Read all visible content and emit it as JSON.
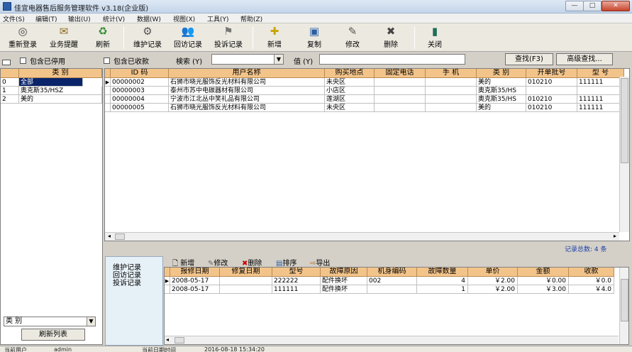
{
  "window": {
    "title": "佳宜电器售后服务管理软件 v3.18(企业版)",
    "minimize_label": "—",
    "maximize_label": "□",
    "close_label": "✕"
  },
  "menu": [
    "文件(S)",
    "编辑(T)",
    "输出(U)",
    "统计(V)",
    "数据(W)",
    "视图(X)",
    "工具(Y)",
    "帮助(Z)"
  ],
  "toolbar": [
    {
      "label": "重新登录",
      "icon": "relogin-icon",
      "glyph": "◎"
    },
    {
      "label": "业务提醒",
      "icon": "reminder-icon",
      "glyph": "✉"
    },
    {
      "label": "刷新",
      "icon": "refresh-icon",
      "glyph": "♻"
    },
    {
      "label": "维护记录",
      "icon": "maintenance-record-icon",
      "glyph": "⚙"
    },
    {
      "label": "回访记录",
      "icon": "revisit-record-icon",
      "glyph": "👥"
    },
    {
      "label": "投诉记录",
      "icon": "complaint-record-icon",
      "glyph": "⚑"
    },
    {
      "label": "新增",
      "icon": "add-icon",
      "glyph": "✚"
    },
    {
      "label": "复制",
      "icon": "copy-icon",
      "glyph": "▣"
    },
    {
      "label": "修改",
      "icon": "edit-icon",
      "glyph": "✎"
    },
    {
      "label": "删除",
      "icon": "delete-icon",
      "glyph": "✖"
    },
    {
      "label": "关闭",
      "icon": "close-door-icon",
      "glyph": "▮"
    }
  ],
  "filters": {
    "include_disabled": "包含已停用",
    "include_closed": "包含已收款",
    "search_label": "検索 (Y)",
    "search_value": "",
    "value_label": "值 (Y)",
    "value_input": "",
    "find_button": "查找(F3)",
    "advanced_button": "高级查找..."
  },
  "category_panel": {
    "header": "类    别",
    "items": [
      {
        "index": "0",
        "name": "全部",
        "selected": true
      },
      {
        "index": "1",
        "name": "奥克斯35/HSZ",
        "selected": false
      },
      {
        "index": "2",
        "name": "美的",
        "selected": false
      }
    ],
    "bottom_select": "类    别",
    "refresh_button": "刷新列表"
  },
  "main_table": {
    "columns": [
      "ID  码",
      "用户名称",
      "购买地点",
      "固定电话",
      "手   机",
      "类   别",
      "开单批号",
      "型   号"
    ],
    "rows": [
      [
        "00000002",
        "石狮市晓光服饰反光材料有限公司",
        "未央区",
        "",
        "",
        "美的",
        "010210",
        "111111"
      ],
      [
        "00000003",
        "泰州市苏中电碳器材有限公司",
        "小店区",
        "",
        "",
        "奥克斯35/HS",
        "",
        ""
      ],
      [
        "00000004",
        "宁波市江北丛中笑礼品有限公司",
        "莲湖区",
        "",
        "",
        "奥克斯35/HS",
        "010210",
        "111111"
      ],
      [
        "00000005",
        "石狮市晓光服饰反光材料有限公司",
        "未央区",
        "",
        "",
        "美的",
        "010210",
        "111111"
      ]
    ],
    "record_count": "记录总数: 4  条"
  },
  "detail_tabs": [
    "维护记录",
    "回访记录",
    "投诉记录"
  ],
  "detail_toolbar": [
    {
      "label": "新增",
      "icon": "new-doc-icon",
      "glyph": "🗋"
    },
    {
      "label": "修改",
      "icon": "edit-icon",
      "glyph": "✎"
    },
    {
      "label": "删除",
      "icon": "delete-icon",
      "glyph": "✖"
    },
    {
      "label": "排序",
      "icon": "sort-icon",
      "glyph": "▤"
    },
    {
      "label": "导出",
      "icon": "export-icon",
      "glyph": "⇨"
    }
  ],
  "detail_table": {
    "columns": [
      "报修日期",
      "修复日期",
      "型号",
      "故障原因",
      "机身编码",
      "故障数量",
      "单价",
      "金额",
      "收款"
    ],
    "rows": [
      [
        "2008-05-17",
        "",
        "222222",
        "配件换坏",
        "002",
        "4",
        "￥2.00",
        "￥0.00",
        "￥0.0"
      ],
      [
        "2008-05-17",
        "",
        "111111",
        "配件换坏",
        "",
        "1",
        "￥2.00",
        "￥3.00",
        "￥4.0"
      ]
    ]
  },
  "status": {
    "user_label": "当前用户",
    "user_value": "admin",
    "date_label": "当前日期时间",
    "date_value": "2016-08-18 15:34:20"
  }
}
